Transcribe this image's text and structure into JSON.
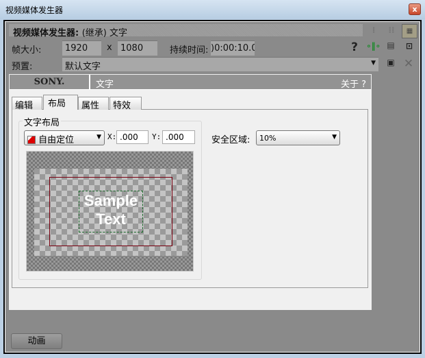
{
  "window": {
    "title": "视频媒体发生器",
    "close": "x"
  },
  "header": {
    "title_bold": "视频媒体发生器:",
    "title_rest": "(继承) 文字"
  },
  "frame": {
    "label": "帧大小:",
    "width": "1920",
    "x": "x",
    "height": "1080",
    "duration_label": "持续时间:",
    "duration": ")0:00:10.0("
  },
  "preset": {
    "label": "预置:",
    "value": "默认文字"
  },
  "toolbar_icons": [
    "help-icon",
    "split-icon",
    "print-icon",
    "select-icon",
    "save-icon",
    "delete-icon"
  ],
  "plugin": {
    "brand": "SONY.",
    "name": "文字",
    "about": "关于 ?"
  },
  "tabs": [
    {
      "label": "编辑"
    },
    {
      "label": "布局",
      "active": true
    },
    {
      "label": "属性"
    },
    {
      "label": "特效"
    }
  ],
  "layout": {
    "group_label": "文字布局",
    "mode": "自由定位",
    "x_label": "X:",
    "x": ".000",
    "y_label": "Y:",
    "y": ".000",
    "safe_label": "安全区域:",
    "safe_value": "10%",
    "sample": "Sample Text"
  },
  "footer": {
    "animation": "动画"
  }
}
